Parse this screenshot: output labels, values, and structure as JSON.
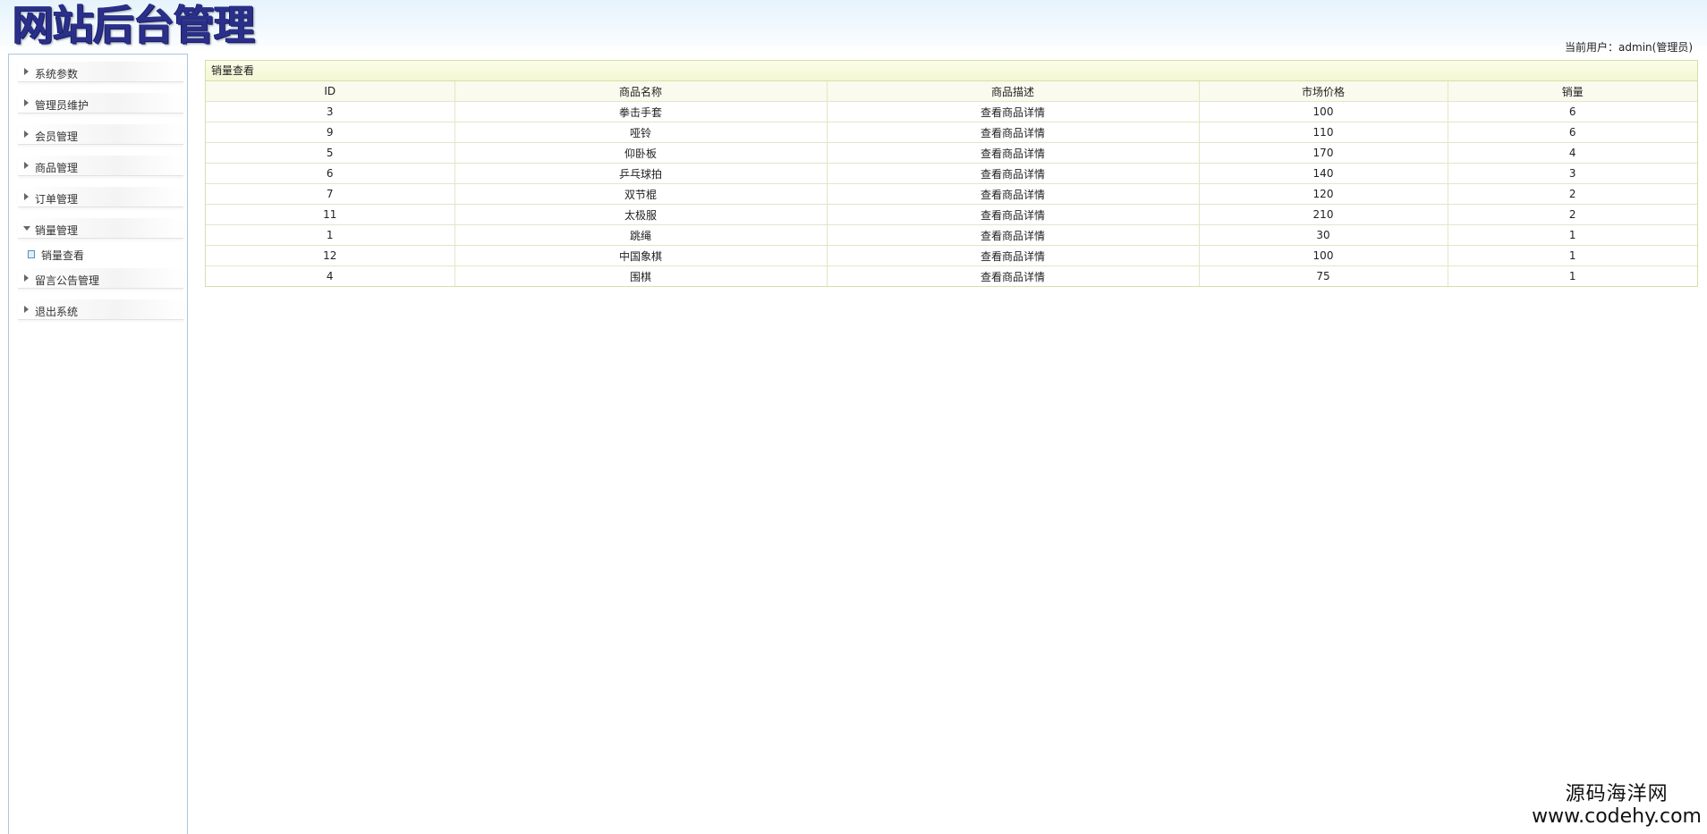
{
  "header": {
    "logo_text": "网站后台管理",
    "current_user": "当前用户：admin(管理员)"
  },
  "sidebar": {
    "items": [
      {
        "label": "系统参数",
        "expanded": false
      },
      {
        "label": "管理员维护",
        "expanded": false
      },
      {
        "label": "会员管理",
        "expanded": false
      },
      {
        "label": "商品管理",
        "expanded": false
      },
      {
        "label": "订单管理",
        "expanded": false
      },
      {
        "label": "销量管理",
        "expanded": true,
        "children": [
          {
            "label": "销量查看"
          }
        ]
      },
      {
        "label": "留言公告管理",
        "expanded": false
      },
      {
        "label": "退出系统",
        "expanded": false
      }
    ]
  },
  "main": {
    "panel_title": "销量查看",
    "columns": [
      "ID",
      "商品名称",
      "商品描述",
      "市场价格",
      "销量"
    ],
    "rows": [
      {
        "id": "3",
        "name": "拳击手套",
        "desc": "查看商品详情",
        "price": "100",
        "sales": "6"
      },
      {
        "id": "9",
        "name": "哑铃",
        "desc": "查看商品详情",
        "price": "110",
        "sales": "6"
      },
      {
        "id": "5",
        "name": "仰卧板",
        "desc": "查看商品详情",
        "price": "170",
        "sales": "4"
      },
      {
        "id": "6",
        "name": "乒乓球拍",
        "desc": "查看商品详情",
        "price": "140",
        "sales": "3"
      },
      {
        "id": "7",
        "name": "双节棍",
        "desc": "查看商品详情",
        "price": "120",
        "sales": "2"
      },
      {
        "id": "11",
        "name": "太极服",
        "desc": "查看商品详情",
        "price": "210",
        "sales": "2"
      },
      {
        "id": "1",
        "name": "跳绳",
        "desc": "查看商品详情",
        "price": "30",
        "sales": "1"
      },
      {
        "id": "12",
        "name": "中国象棋",
        "desc": "查看商品详情",
        "price": "100",
        "sales": "1"
      },
      {
        "id": "4",
        "name": "围棋",
        "desc": "查看商品详情",
        "price": "75",
        "sales": "1"
      }
    ]
  },
  "watermark": {
    "line1": "源码海洋网",
    "line2": "www.codehy.com"
  },
  "colors": {
    "logo": "#2a2f8a",
    "sidebar_border": "#a9c6dd",
    "panel_border": "#d6dfa6",
    "panel_title_bg": "#f3f7d2"
  }
}
